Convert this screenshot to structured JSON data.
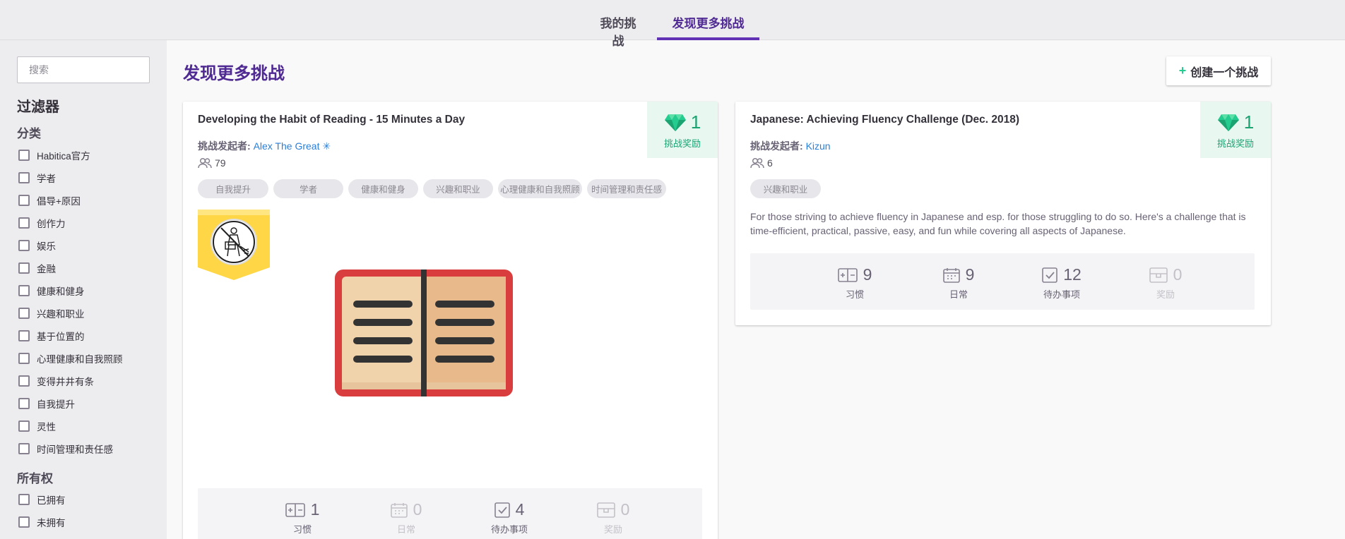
{
  "top_tabs": {
    "my_challenges": "我的挑战",
    "discover": "发现更多挑战"
  },
  "sidebar": {
    "search_placeholder": "搜索",
    "filters_title": "过滤器",
    "category_heading": "分类",
    "categories": [
      "Habitica官方",
      "学者",
      "倡导+原因",
      "创作力",
      "娱乐",
      "金融",
      "健康和健身",
      "兴趣和职业",
      "基于位置的",
      "心理健康和自我照顾",
      "变得井井有条",
      "自我提升",
      "灵性",
      "时间管理和责任感"
    ],
    "ownership_heading": "所有权",
    "ownership": [
      "已拥有",
      "未拥有"
    ]
  },
  "main": {
    "title": "发现更多挑战",
    "create_button": "创建一个挑战",
    "leader_label": "挑战发起者:",
    "stat_labels": [
      "习惯",
      "日常",
      "待办事项",
      "奖励"
    ],
    "prize_label": "挑战奖励",
    "challenges": [
      {
        "title": "Developing the Habit of Reading - 15 Minutes a Day",
        "leader": "Alex The Great ✳",
        "members": "79",
        "prize": "1",
        "tags": [
          "自我提升",
          "学者",
          "健康和健身",
          "兴趣和职业",
          "心理健康和自我照顾",
          "时间管理和责任感"
        ],
        "stats": [
          "1",
          "0",
          "4",
          "0"
        ]
      },
      {
        "title": "Japanese: Achieving Fluency Challenge (Dec. 2018)",
        "leader": "Kizun",
        "members": "6",
        "prize": "1",
        "tags": [
          "兴趣和职业"
        ],
        "description": "For those striving to achieve fluency in Japanese and esp. for those struggling to do so. Here's a challenge that is time-efficient, practical, passive, easy, and fun while covering all aspects of Japanese.",
        "stats": [
          "9",
          "9",
          "12",
          "0"
        ]
      }
    ]
  },
  "colors": {
    "brand_purple": "#4f2a93",
    "gem_green": "#1ca372",
    "link_blue": "#2a7fd9",
    "sidebar_bg": "#edecee"
  },
  "icons": [
    "diamond-icon",
    "members-icon",
    "habit-icon",
    "daily-icon",
    "todo-icon",
    "reward-icon",
    "book-icon",
    "guild-badge-icon"
  ]
}
